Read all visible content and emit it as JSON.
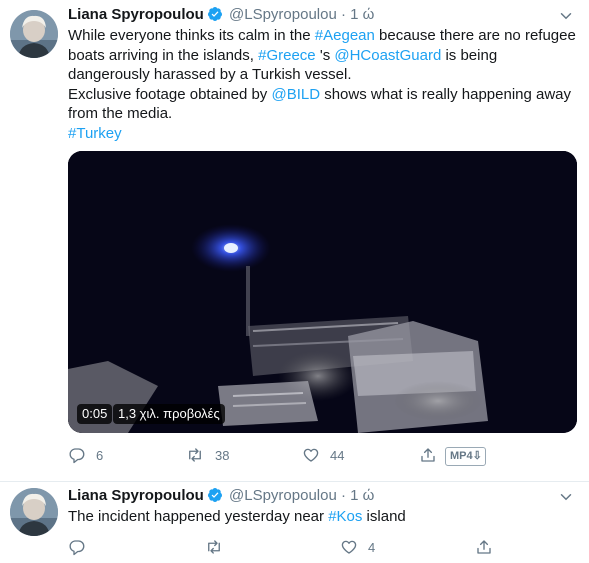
{
  "tweets": [
    {
      "author_name": "Liana Spyropoulou",
      "handle": "@LSpyropoulou",
      "separator": "·",
      "time": "1 ώ",
      "text_lines": [
        [
          {
            "t": "While everyone thinks its calm in the "
          },
          {
            "t": "#Aegean",
            "link": true
          },
          {
            "t": " because there are no refugee boats arriving in the islands, "
          },
          {
            "t": "#Greece",
            "link": true
          },
          {
            "t": " 's "
          },
          {
            "t": "@HCoastGuard",
            "link": true
          },
          {
            "t": " is being dangerously harassed by a Turkish vessel."
          }
        ],
        [
          {
            "t": "Exclusive footage obtained by "
          },
          {
            "t": "@BILD",
            "link": true
          },
          {
            "t": " shows what is really happening away from the media."
          }
        ],
        [
          {
            "t": "#Turkey",
            "link": true
          }
        ]
      ],
      "video": {
        "duration": "0:05",
        "views": "1,3 χιλ. προβολές"
      },
      "actions": {
        "reply_count": "6",
        "retweet_count": "38",
        "like_count": "44",
        "format_label": "MP4"
      }
    },
    {
      "author_name": "Liana Spyropoulou",
      "handle": "@LSpyropoulou",
      "separator": "·",
      "time": "1 ώ",
      "text_lines": [
        [
          {
            "t": "The incident happened yesterday near "
          },
          {
            "t": "#Kos",
            "link": true
          },
          {
            "t": " island"
          }
        ]
      ],
      "actions": {
        "reply_count": "",
        "retweet_count": "",
        "like_count": "4"
      }
    }
  ],
  "colors": {
    "link": "#1da1f2",
    "muted": "#657786",
    "verified": "#1da1f2",
    "divider": "#e6ecf0"
  }
}
